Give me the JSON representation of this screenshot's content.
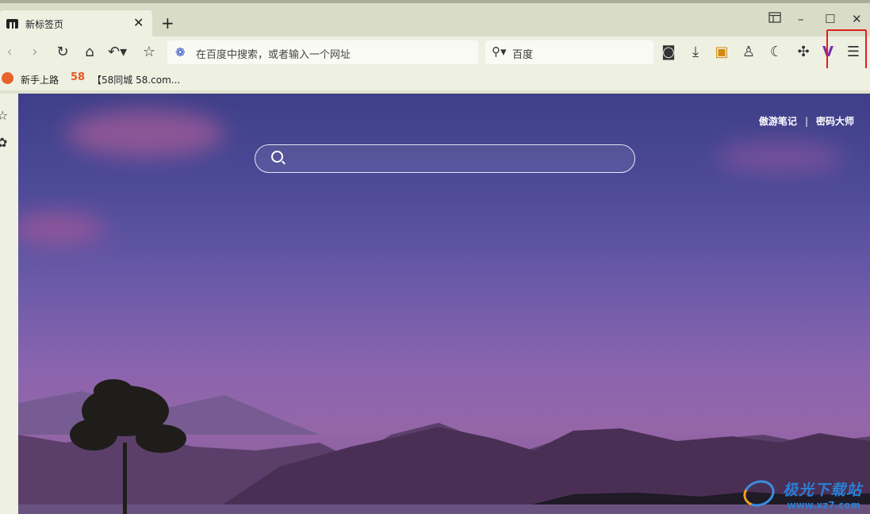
{
  "tab": {
    "title": "新标签页"
  },
  "address_bar": {
    "placeholder": "在百度中搜索，或者输入一个网址"
  },
  "search_box": {
    "engine": "百度"
  },
  "bookmarks": [
    {
      "label": "新手上路"
    },
    {
      "label": "【58同城 58.com..."
    }
  ],
  "bookmark_58_badge": "58",
  "content": {
    "links": [
      "傲游笔记",
      "密码大师"
    ],
    "separator": "|"
  },
  "watermark": {
    "title": "极光下载站",
    "url": "www.xz7.com"
  },
  "colors": {
    "highlight": "#e02020",
    "accent": "#2b4ec7"
  },
  "icons": [
    "back-icon",
    "forward-icon",
    "reload-icon",
    "home-icon",
    "undo-icon",
    "star-icon",
    "camera-icon",
    "download-icon",
    "notes-icon",
    "account-icon",
    "night-mode-icon",
    "extensions-icon",
    "maxthon-v-icon",
    "menu-icon"
  ]
}
